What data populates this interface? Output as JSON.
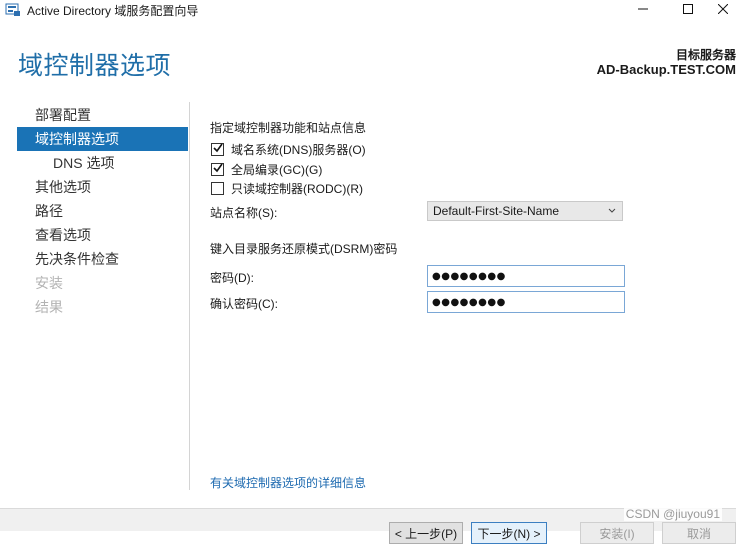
{
  "window": {
    "title": "Active Directory 域服务配置向导"
  },
  "header": {
    "page_title": "域控制器选项",
    "target_label": "目标服务器",
    "target_server": "AD-Backup.TEST.COM"
  },
  "nav": {
    "items": [
      {
        "label": "部署配置",
        "state": "normal"
      },
      {
        "label": "域控制器选项",
        "state": "active"
      },
      {
        "label": "DNS 选项",
        "state": "sub"
      },
      {
        "label": "其他选项",
        "state": "normal"
      },
      {
        "label": "路径",
        "state": "normal"
      },
      {
        "label": "查看选项",
        "state": "normal"
      },
      {
        "label": "先决条件检查",
        "state": "normal"
      },
      {
        "label": "安装",
        "state": "disabled"
      },
      {
        "label": "结果",
        "state": "disabled"
      }
    ]
  },
  "content": {
    "capabilities_heading": "指定域控制器功能和站点信息",
    "dns_checkbox": {
      "label": "域名系统(DNS)服务器(O)",
      "checked": true
    },
    "gc_checkbox": {
      "label": "全局编录(GC)(G)",
      "checked": true
    },
    "rodc_checkbox": {
      "label": "只读域控制器(RODC)(R)",
      "checked": false
    },
    "site_label": "站点名称(S):",
    "site_value": "Default-First-Site-Name",
    "dsrm_heading": "键入目录服务还原模式(DSRM)密码",
    "password_label": "密码(D):",
    "password_value": "●●●●●●●●",
    "confirm_label": "确认密码(C):",
    "confirm_value": "●●●●●●●●",
    "more_info_link": "有关域控制器选项的详细信息"
  },
  "footer": {
    "prev_label": "< 上一步(P)",
    "next_label": "下一步(N) >",
    "install_label": "安装(I)",
    "cancel_label": "取消"
  },
  "watermark": "CSDN @jiuyou91",
  "colors": {
    "accent": "#1a73b6",
    "title_blue": "#1f6ea8",
    "link": "#1d6ab0"
  },
  "icons": {
    "app": "server-wizard-icon",
    "minimize": "minimize-icon",
    "maximize": "maximize-icon",
    "close": "close-icon",
    "dropdown": "chevron-down-icon",
    "check": "check-icon"
  }
}
